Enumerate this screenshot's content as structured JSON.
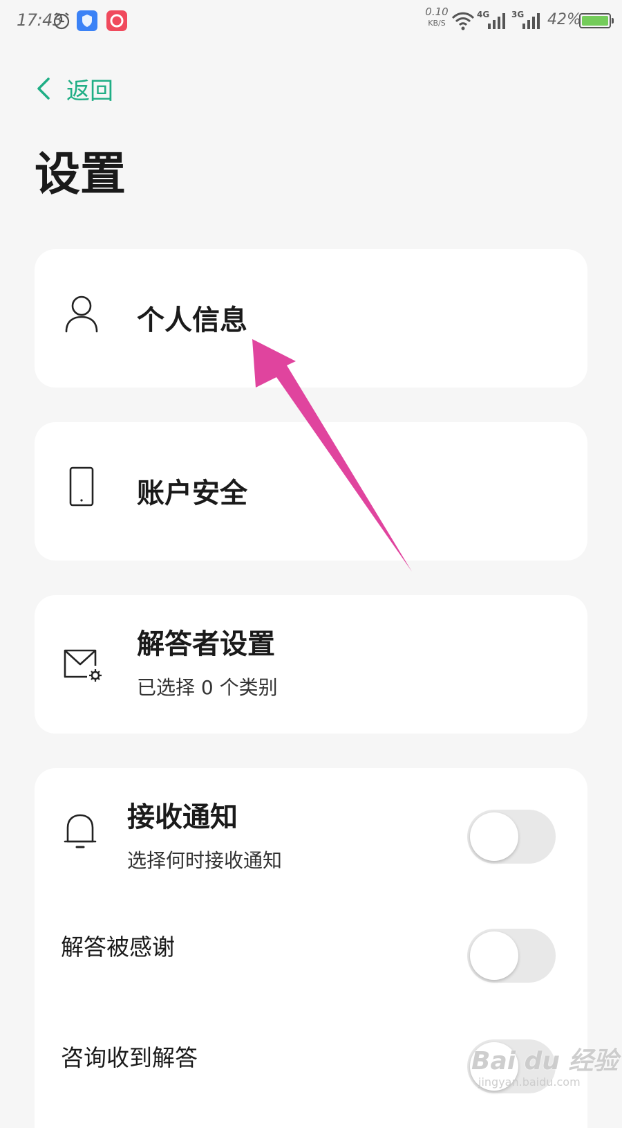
{
  "status_bar": {
    "time": "17:43",
    "net_speed": "0.10",
    "net_speed_unit": "KB/S",
    "net1_label": "4G",
    "net2_label": "3G",
    "battery_text": "42%",
    "battery_level": 0.42,
    "icons": [
      "alarm-icon",
      "shield-icon",
      "app-icon",
      "wifi-icon",
      "signal-icon",
      "battery-icon"
    ]
  },
  "nav": {
    "back_label": "返回"
  },
  "page": {
    "title": "设置"
  },
  "items": {
    "personal_info": {
      "title": "个人信息",
      "icon": "person-icon"
    },
    "account_security": {
      "title": "账户安全",
      "icon": "phone-icon"
    },
    "answerer_settings": {
      "title": "解答者设置",
      "subtitle": "已选择 0 个类别",
      "icon": "mail-gear-icon"
    },
    "notifications": {
      "title": "接收通知",
      "subtitle": "选择何时接收通知",
      "icon": "bell-icon",
      "enabled": false,
      "options": [
        {
          "label": "解答被感谢",
          "enabled": false
        },
        {
          "label": "咨询收到解答",
          "enabled": false
        }
      ]
    }
  },
  "watermark": {
    "main": "Bai du 经验",
    "sub": "jingyan.baidu.com"
  },
  "colors": {
    "accent": "#1fae85",
    "annotation_arrow": "#e0449e",
    "background": "#f6f6f6",
    "card": "#ffffff",
    "toggle_off": "#e8e8e8"
  }
}
